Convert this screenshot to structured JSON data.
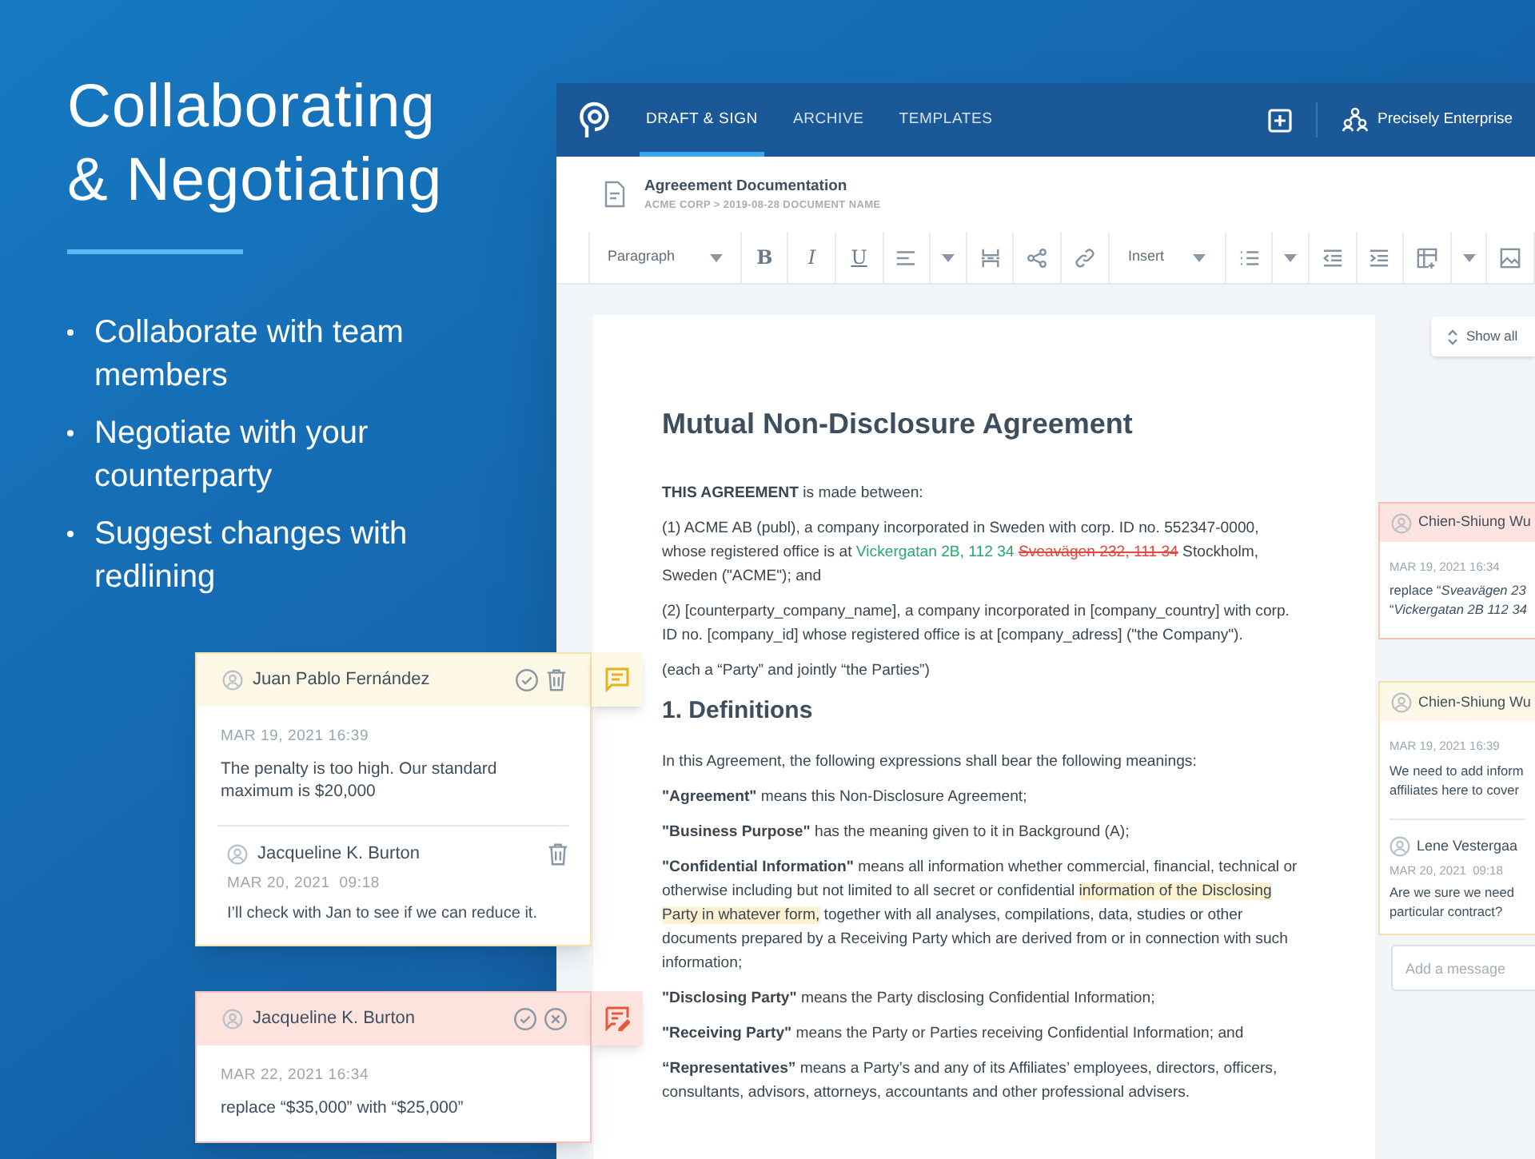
{
  "hero": {
    "title_lines": [
      "Collaborating",
      "& Negotiating"
    ],
    "bullets": [
      "Collaborate with team members",
      "Negotiate with your counterparty",
      "Suggest changes with redlining"
    ]
  },
  "app": {
    "nav_tabs": [
      {
        "label": "DRAFT & SIGN",
        "selected": true
      },
      {
        "label": "ARCHIVE",
        "selected": false
      },
      {
        "label": "TEMPLATES",
        "selected": false
      }
    ],
    "account": "Precisely Enterprise",
    "document_header": {
      "title": "Agreeement Documentation",
      "breadcrumb": "ACME CORP > 2019-08-28 DOCUMENT NAME"
    },
    "toolbar": {
      "style_dropdown": "Paragraph",
      "bold": "B",
      "italic": "I",
      "underline": "U",
      "insert_dropdown": "Insert"
    },
    "document": {
      "title": "Mutual Non-Disclosure Agreement",
      "blocks": [
        {
          "kind": "paragraph",
          "segments": [
            {
              "kind": "normal",
              "text": "**THIS AGREEMENT** is made between:"
            }
          ]
        },
        {
          "kind": "paragraph",
          "segments": [
            {
              "kind": "normal",
              "text": "(1) ACME AB (publ), a company incorporated in Sweden with corp. ID no. 552347-0000, whose registered office is at "
            },
            {
              "kind": "inserted",
              "text": "Vickergatan 2B, 112 34 "
            },
            {
              "kind": "deleted",
              "text": "Sveavägen 232, 111 34"
            },
            {
              "kind": "normal",
              "text": " Stockholm, Sweden (\"ACME\"); and"
            }
          ]
        },
        {
          "kind": "paragraph",
          "segments": [
            {
              "kind": "normal",
              "text": "(2) [counterparty_company_name], a company incorporated in [company_country] with corp. ID no. [company_id] whose registered office is at [company_adress] (\"the Company\")."
            }
          ]
        },
        {
          "kind": "paragraph",
          "segments": [
            {
              "kind": "normal",
              "text": "(each a “Party” and jointly “the Parties”)"
            }
          ]
        },
        {
          "kind": "heading",
          "segments": [
            {
              "kind": "normal",
              "text": "1. Definitions"
            }
          ]
        },
        {
          "kind": "paragraph",
          "segments": [
            {
              "kind": "normal",
              "text": "In this Agreement, the following expressions shall bear the following meanings:"
            }
          ]
        },
        {
          "kind": "paragraph",
          "segments": [
            {
              "kind": "normal",
              "text": "**\"Agreement\"** means this Non-Disclosure Agreement;"
            }
          ]
        },
        {
          "kind": "paragraph",
          "segments": [
            {
              "kind": "normal",
              "text": "**\"Business Purpose\"** has the meaning given to it in Background (A);"
            }
          ]
        },
        {
          "kind": "paragraph",
          "segments": [
            {
              "kind": "normal",
              "text": "**\"Confidential Information\"** means all information whether commercial, financial, technical or otherwise including but not limited to all secret or confidential "
            },
            {
              "kind": "highlight",
              "text": "information of the Disclosing Party in whatever form,"
            },
            {
              "kind": "normal",
              "text": " together with all analyses, compilations, data, studies or other documents prepared by a Receiving Party which are derived from or in connection with such information;"
            }
          ]
        },
        {
          "kind": "paragraph",
          "segments": [
            {
              "kind": "normal",
              "text": "**\"Disclosing Party\"** means the Party disclosing Confidential Information;"
            }
          ]
        },
        {
          "kind": "paragraph",
          "segments": [
            {
              "kind": "normal",
              "text": "**\"Receiving Party\"** means the Party or Parties receiving Confidential Information; and"
            }
          ]
        },
        {
          "kind": "paragraph",
          "segments": [
            {
              "kind": "normal",
              "text": "**“Representatives”** means a Party’s and any of its Affiliates’ employees, directors, officers, consultants, advisors, attorneys, accountants and other professional advisers."
            }
          ]
        }
      ]
    },
    "show_all_button": "Show all",
    "side_comments": [
      {
        "kind": "suggestion",
        "author": "Chien-Shiung Wu",
        "date": "MAR 19, 2021 16:34",
        "lines": [
          "replace “*Sveavägen 23*",
          "“*Vickergatan 2B 112 34*"
        ]
      },
      {
        "kind": "comment",
        "author": "Chien-Shiung Wu",
        "date": "MAR 19, 2021 16:39",
        "lines": [
          "We need to add inform",
          "affiliates here to cover"
        ],
        "replies": [
          {
            "author": "Lene Vestergaa",
            "date": "MAR 20, 2021  09:18",
            "lines": [
              "Are we sure we need",
              "particular contract?"
            ]
          }
        ]
      }
    ],
    "message_placeholder": "Add a message"
  },
  "floating_comments": [
    {
      "kind": "comment",
      "author": "Juan Pablo Fernández",
      "date": "MAR 19, 2021 16:39",
      "text": "The penalty is too high. Our standard maximum is $20,000",
      "replies": [
        {
          "author": "Jacqueline K. Burton",
          "date": "MAR 20, 2021  09:18",
          "text": "I’ll check with Jan to see if we can reduce it."
        }
      ]
    },
    {
      "kind": "suggestion",
      "author": "Jacqueline K. Burton",
      "date": "MAR 22, 2021 16:34",
      "text": "replace “$35,000” with “$25,000”"
    }
  ]
}
